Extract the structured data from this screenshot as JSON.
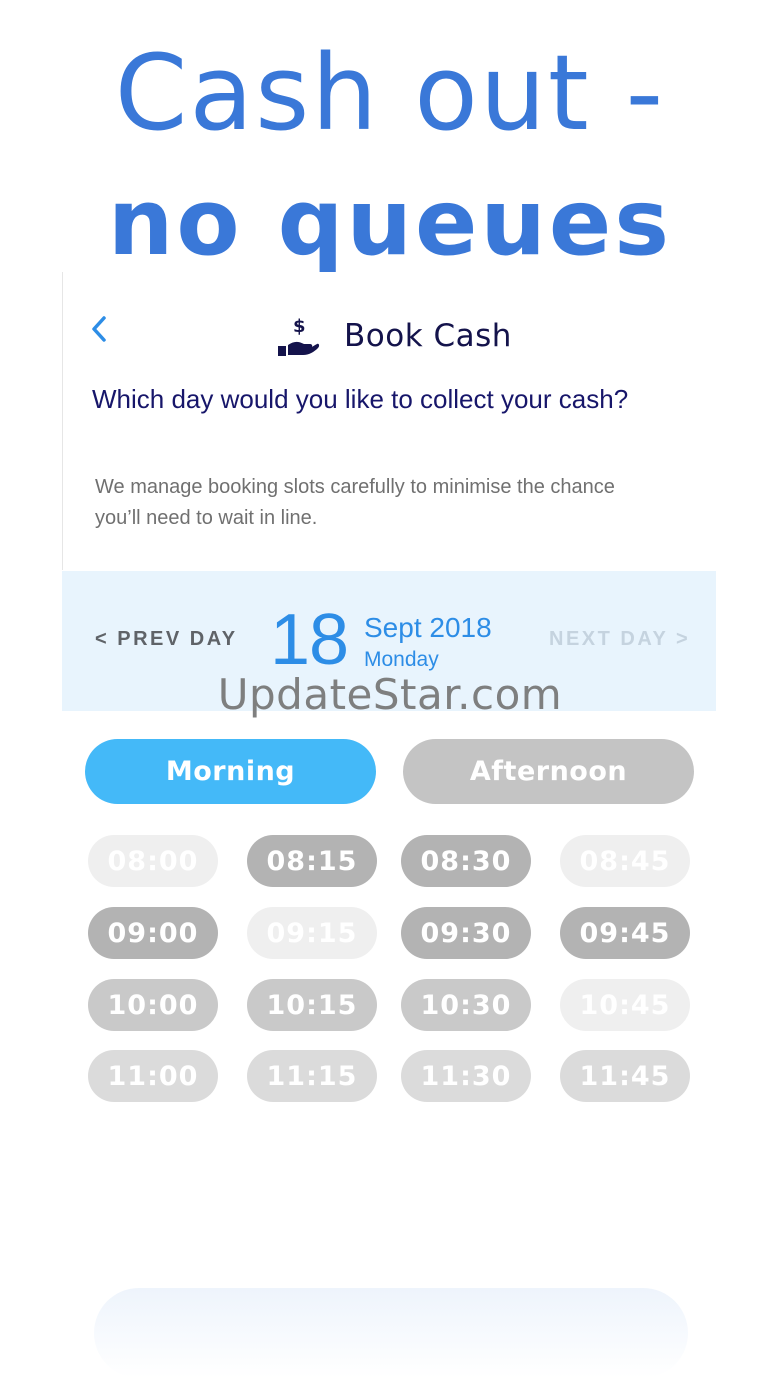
{
  "headline": {
    "line1": "Cash out -",
    "line2": "no queues"
  },
  "nav": {
    "back_icon": "chevron-left-icon",
    "title_icon": "hand-dollar-icon",
    "title": "Book Cash"
  },
  "question": "Which day would you like to collect your cash?",
  "subtext": "We manage booking slots carefully to minimise the chance you’ll need to wait in line.",
  "date_picker": {
    "prev_label": "< PREV DAY",
    "next_label": "NEXT DAY >",
    "day": "18",
    "month_year": "Sept 2018",
    "weekday": "Monday"
  },
  "watermark": "UpdateStar.com",
  "period_toggle": {
    "morning": "Morning",
    "afternoon": "Afternoon",
    "selected": "Morning"
  },
  "slots": [
    {
      "time": "08:00",
      "state": "unavailable"
    },
    {
      "time": "08:15",
      "state": "available"
    },
    {
      "time": "08:30",
      "state": "available"
    },
    {
      "time": "08:45",
      "state": "unavailable"
    },
    {
      "time": "09:00",
      "state": "available"
    },
    {
      "time": "09:15",
      "state": "unavailable"
    },
    {
      "time": "09:30",
      "state": "available"
    },
    {
      "time": "09:45",
      "state": "available"
    },
    {
      "time": "10:00",
      "state": "available"
    },
    {
      "time": "10:15",
      "state": "available"
    },
    {
      "time": "10:30",
      "state": "available"
    },
    {
      "time": "10:45",
      "state": "unavailable"
    },
    {
      "time": "11:00",
      "state": "available"
    },
    {
      "time": "11:15",
      "state": "available"
    },
    {
      "time": "11:30",
      "state": "available"
    },
    {
      "time": "11:45",
      "state": "available"
    }
  ],
  "colors": {
    "accent": "#2d8de6",
    "headline": "#3a78d8",
    "toggle_selected": "#44b9f8",
    "toggle_unselected": "#c4c4c4",
    "date_band": "#e8f4fd",
    "title_navy": "#14134b"
  }
}
